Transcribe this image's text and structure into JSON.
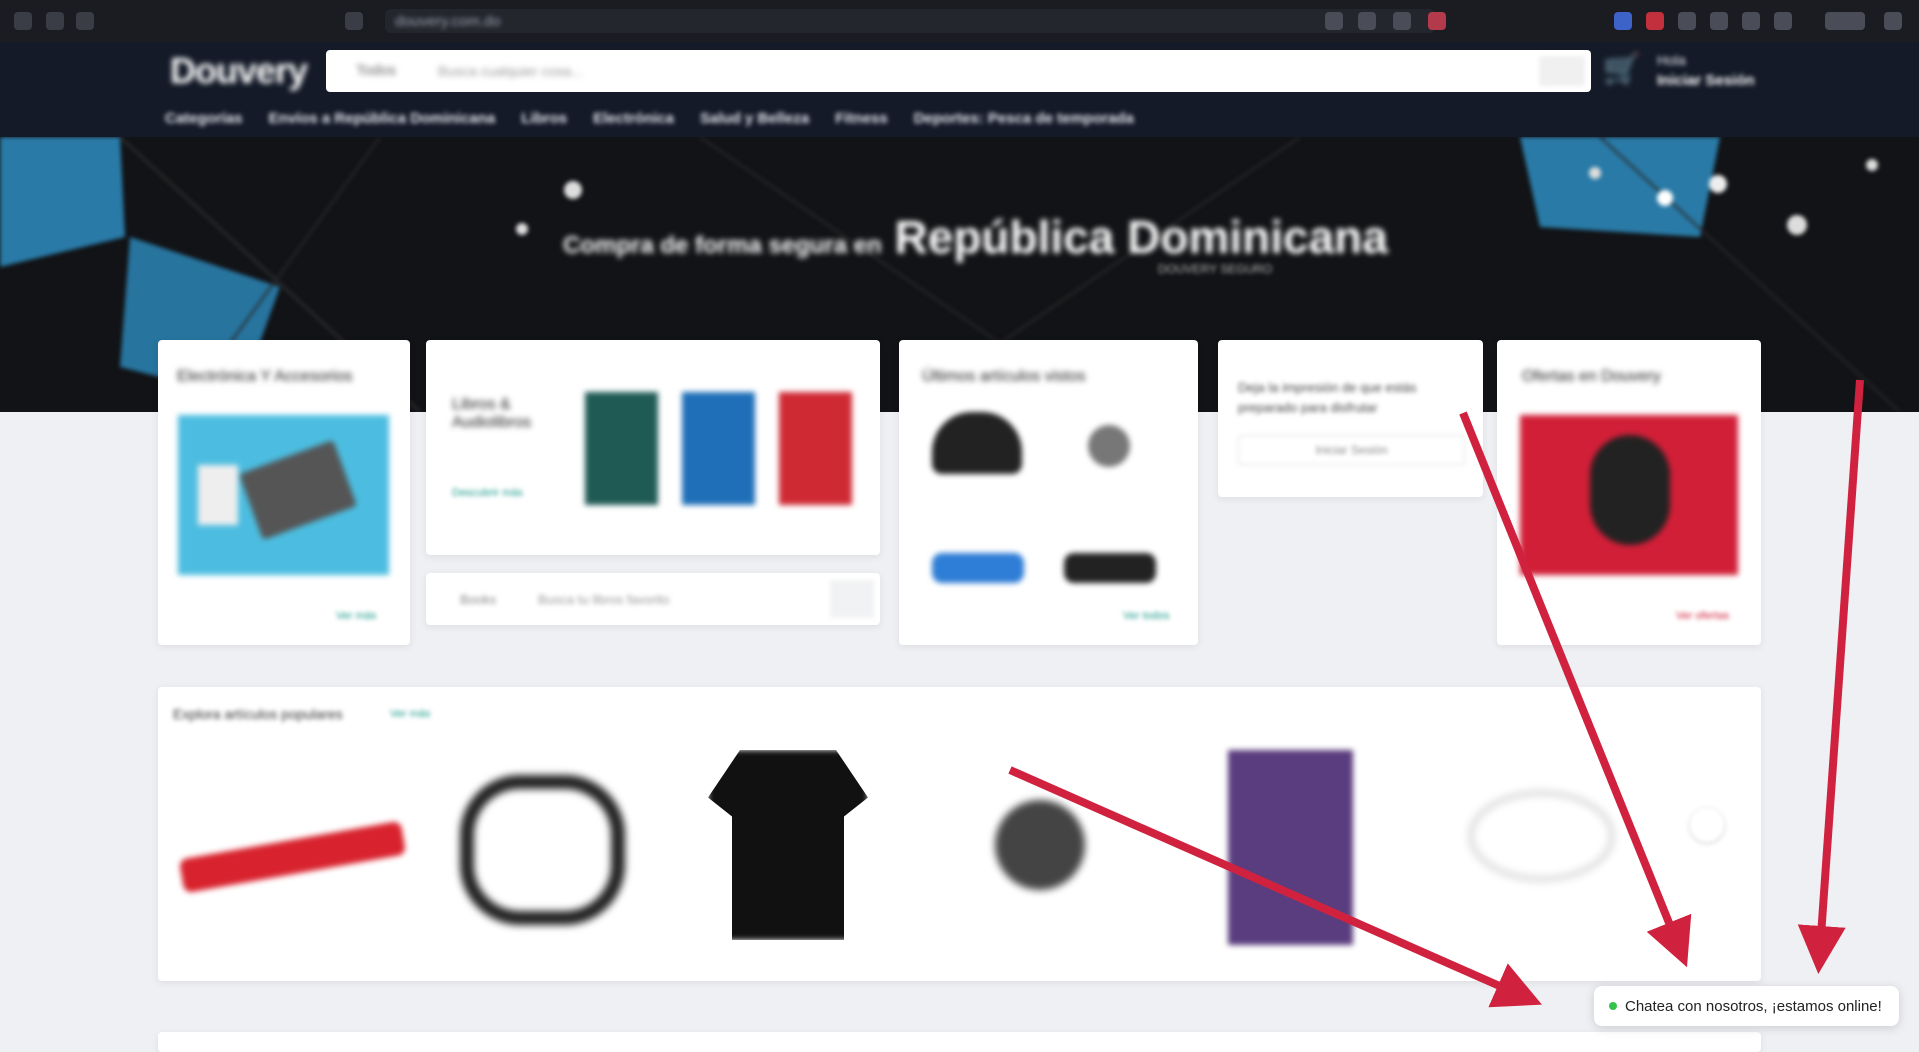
{
  "browser": {
    "url": "douvery.com.do"
  },
  "header": {
    "logo": "Douvery",
    "search_category": "Todos",
    "search_placeholder": "Busca cualquier cosa...",
    "greeting": "Hola",
    "login_label": "Iniciar Sesión",
    "nav": [
      "Categorías",
      "Envíos a República Dominicana",
      "Libros",
      "Electrónica",
      "Salud y Belleza",
      "Fitness",
      "Deportes: Pesca de temporada"
    ]
  },
  "hero": {
    "title_prefix": "Compra de forma segura en",
    "title": "República Dominicana",
    "subtitle": "DOUVERY SEGURO"
  },
  "cards": {
    "electronics": {
      "title": "Electrónica Y Accesorios",
      "link": "Ver más"
    },
    "books": {
      "title": "Libros & Audiolibros",
      "link": "Descubrir más",
      "search_category": "Books",
      "search_placeholder": "Busca tu libros favorito"
    },
    "recent": {
      "title": "Últimos artículos vistos",
      "link": "Ver todos"
    },
    "login": {
      "text": "Deja la impresión de que estás preparado para disfrutar",
      "button": "Iniciar Sesión"
    },
    "deals": {
      "title": "Ofertas en Douvery",
      "link": "Ver ofertas"
    },
    "popular": {
      "title": "Explora artículos populares",
      "link": "Ver más"
    }
  },
  "chat": {
    "label": "Chatea con nosotros, ¡estamos online!",
    "status_color": "#35c24a"
  },
  "colors": {
    "accent": "#1a9a8a",
    "annotation_arrow": "#d0223f",
    "header_bg": "#141a28"
  }
}
